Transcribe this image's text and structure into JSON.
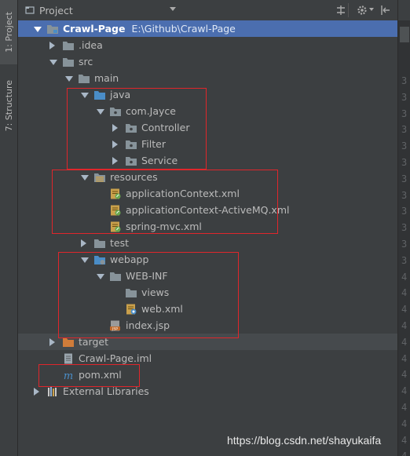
{
  "stripe": {
    "project_tab": "1: Project",
    "structure_tab": "7: Structure"
  },
  "header": {
    "title": "Project"
  },
  "tree": [
    {
      "label": "Crawl-Page",
      "path": "E:\\Github\\Crawl-Page",
      "depth": 0,
      "arrow": "open",
      "icon": "module-folder-icon",
      "selected": true
    },
    {
      "label": ".idea",
      "depth": 1,
      "arrow": "closed",
      "icon": "folder-icon"
    },
    {
      "label": "src",
      "depth": 1,
      "arrow": "open",
      "icon": "folder-icon"
    },
    {
      "label": "main",
      "depth": 2,
      "arrow": "open",
      "icon": "folder-icon"
    },
    {
      "label": "java",
      "depth": 3,
      "arrow": "open",
      "icon": "source-folder-icon"
    },
    {
      "label": "com.Jayce",
      "depth": 4,
      "arrow": "open",
      "icon": "package-icon"
    },
    {
      "label": "Controller",
      "depth": 5,
      "arrow": "closed",
      "icon": "package-icon"
    },
    {
      "label": "Filter",
      "depth": 5,
      "arrow": "closed",
      "icon": "package-icon"
    },
    {
      "label": "Service",
      "depth": 5,
      "arrow": "closed",
      "icon": "package-icon"
    },
    {
      "label": "resources",
      "depth": 3,
      "arrow": "open",
      "icon": "resources-folder-icon"
    },
    {
      "label": "applicationContext.xml",
      "depth": 4,
      "arrow": "none",
      "icon": "spring-xml-icon"
    },
    {
      "label": "applicationContext-ActiveMQ.xml",
      "depth": 4,
      "arrow": "none",
      "icon": "spring-xml-icon"
    },
    {
      "label": "spring-mvc.xml",
      "depth": 4,
      "arrow": "none",
      "icon": "spring-xml-icon"
    },
    {
      "label": "test",
      "depth": 3,
      "arrow": "closed",
      "icon": "folder-icon"
    },
    {
      "label": "webapp",
      "depth": 3,
      "arrow": "open",
      "icon": "web-folder-icon"
    },
    {
      "label": "WEB-INF",
      "depth": 4,
      "arrow": "open",
      "icon": "folder-icon"
    },
    {
      "label": "views",
      "depth": 5,
      "arrow": "none",
      "icon": "folder-icon"
    },
    {
      "label": "web.xml",
      "depth": 5,
      "arrow": "none",
      "icon": "web-xml-icon"
    },
    {
      "label": "index.jsp",
      "depth": 4,
      "arrow": "none",
      "icon": "jsp-icon"
    },
    {
      "label": "target",
      "depth": 1,
      "arrow": "closed",
      "icon": "excluded-folder-icon",
      "highlight": true
    },
    {
      "label": "Crawl-Page.iml",
      "depth": 1,
      "arrow": "none",
      "icon": "iml-file-icon"
    },
    {
      "label": "pom.xml",
      "depth": 1,
      "arrow": "none",
      "icon": "maven-icon"
    },
    {
      "label": "External Libraries",
      "depth": 0,
      "arrow": "closed",
      "icon": "libraries-icon"
    }
  ],
  "gutter_numbers": [
    "3",
    "3",
    "3",
    "3",
    "3",
    "3",
    "3",
    "3",
    "3",
    "3",
    "3",
    "3",
    "4",
    "4",
    "4",
    "4",
    "4",
    "4",
    "4",
    "4",
    "4",
    "4",
    "4",
    "4",
    "4"
  ],
  "colors": {
    "background": "#3c3f41",
    "selection": "#4b6eaf",
    "annotation": "#e0262b",
    "folder": "#87939a",
    "source": "#4a8dc7"
  },
  "watermark": "https://blog.csdn.net/shayukaifa"
}
